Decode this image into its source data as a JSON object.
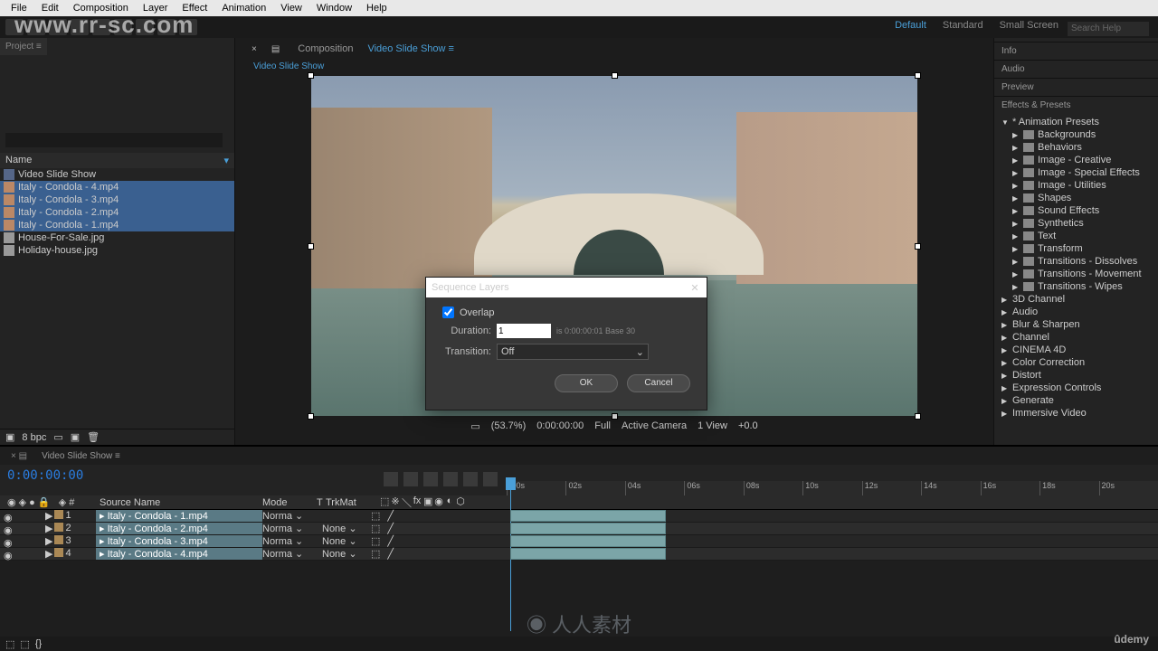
{
  "menu": [
    "File",
    "Edit",
    "Composition",
    "Layer",
    "Effect",
    "Animation",
    "View",
    "Window",
    "Help"
  ],
  "workspace": {
    "tabs": [
      "Default",
      "Standard",
      "Small Screen"
    ],
    "active": "Default",
    "search": "Search Help"
  },
  "watermark": "www.rr-sc.com",
  "watermark_logo": "◉ 人人素材",
  "udemy": "ûdemy",
  "project": {
    "tab": "Project ≡",
    "name_col": "Name",
    "items": [
      {
        "name": "Video Slide Show",
        "type": "comp",
        "sel": false
      },
      {
        "name": "Italy - Condola - 4.mp4",
        "type": "vid",
        "sel": true
      },
      {
        "name": "Italy - Condola - 3.mp4",
        "type": "vid",
        "sel": true
      },
      {
        "name": "Italy - Condola - 2.mp4",
        "type": "vid",
        "sel": true
      },
      {
        "name": "Italy - Condola - 1.mp4",
        "type": "vid",
        "sel": true
      },
      {
        "name": "House-For-Sale.jpg",
        "type": "img",
        "sel": false
      },
      {
        "name": "Holiday-house.jpg",
        "type": "img",
        "sel": false
      }
    ],
    "bpc": "8 bpc"
  },
  "comp": {
    "tab_prefix": "Composition",
    "tab": "Video Slide Show ≡",
    "crumb": "Video Slide Show",
    "zoom": "(53.7%)",
    "res": "Full",
    "camera": "Active Camera",
    "views": "1 View",
    "timecode": "0:00:00:00"
  },
  "right_panels": [
    "Info",
    "Audio",
    "Preview",
    "Effects & Presets"
  ],
  "presets": {
    "root": "* Animation Presets",
    "folders": [
      "Backgrounds",
      "Behaviors",
      "Image - Creative",
      "Image - Special Effects",
      "Image - Utilities",
      "Shapes",
      "Sound Effects",
      "Synthetics",
      "Text",
      "Transform",
      "Transitions - Dissolves",
      "Transitions - Movement",
      "Transitions - Wipes"
    ],
    "cats": [
      "3D Channel",
      "Audio",
      "Blur & Sharpen",
      "Channel",
      "CINEMA 4D",
      "Color Correction",
      "Distort",
      "Expression Controls",
      "Generate",
      "Immersive Video"
    ]
  },
  "timeline": {
    "tab": "Video Slide Show ≡",
    "timecode": "0:00:00:00",
    "cols": {
      "source": "Source Name",
      "mode": "Mode",
      "trkmat": "TrkMat"
    },
    "ticks": [
      ":00s",
      "02s",
      "04s",
      "06s",
      "08s",
      "10s",
      "12s",
      "14s",
      "16s",
      "18s",
      "20s"
    ],
    "layers": [
      {
        "idx": "1",
        "name": "Italy - Condola - 1.mp4",
        "mode": "Norma",
        "trk": ""
      },
      {
        "idx": "2",
        "name": "Italy - Condola - 2.mp4",
        "mode": "Norma",
        "trk": "None"
      },
      {
        "idx": "3",
        "name": "Italy - Condola - 3.mp4",
        "mode": "Norma",
        "trk": "None"
      },
      {
        "idx": "4",
        "name": "Italy - Condola - 4.mp4",
        "mode": "Norma",
        "trk": "None"
      }
    ]
  },
  "dialog": {
    "title": "Sequence Layers",
    "overlap": "Overlap",
    "duration_label": "Duration:",
    "duration_value": "1",
    "duration_hint": "is 0:00:00:01  Base 30",
    "transition_label": "Transition:",
    "transition_value": "Off",
    "ok": "OK",
    "cancel": "Cancel"
  }
}
